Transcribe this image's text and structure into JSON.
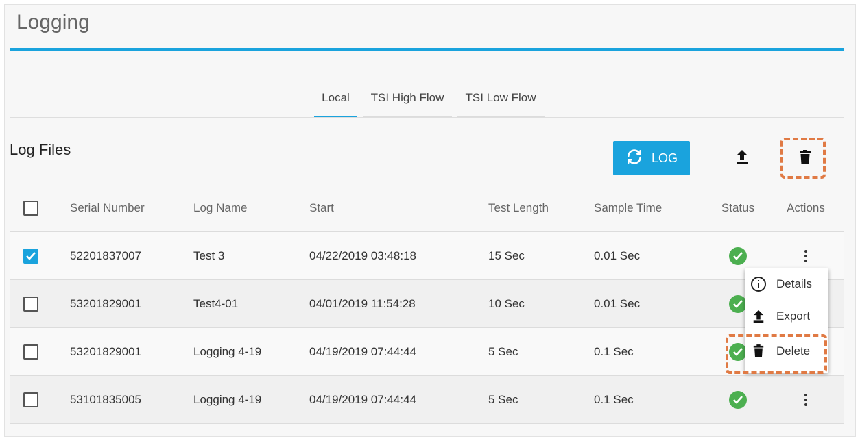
{
  "page": {
    "title": "Logging"
  },
  "tabs": [
    {
      "label": "Local",
      "active": true
    },
    {
      "label": "TSI High Flow",
      "active": false
    },
    {
      "label": "TSI Low Flow",
      "active": false
    }
  ],
  "section": {
    "title": "Log Files"
  },
  "toolbar": {
    "log_label": "LOG",
    "log_icon": "refresh-icon",
    "upload_icon": "upload-icon",
    "delete_icon": "trash-icon"
  },
  "table": {
    "columns": [
      "Serial Number",
      "Log Name",
      "Start",
      "Test Length",
      "Sample Time",
      "Status",
      "Actions"
    ],
    "rows": [
      {
        "checked": true,
        "serial": "52201837007",
        "name": "Test 3",
        "start": "04/22/2019 03:48:18",
        "length": "15 Sec",
        "sample": "0.01 Sec",
        "status": "ok"
      },
      {
        "checked": false,
        "serial": "53201829001",
        "name": "Test4-01",
        "start": "04/01/2019 11:54:28",
        "length": "10 Sec",
        "sample": "0.01 Sec",
        "status": "ok"
      },
      {
        "checked": false,
        "serial": "53201829001",
        "name": "Logging 4-19",
        "start": "04/19/2019 07:44:44",
        "length": "5 Sec",
        "sample": "0.1 Sec",
        "status": "ok"
      },
      {
        "checked": false,
        "serial": "53101835005",
        "name": "Logging 4-19",
        "start": "04/19/2019 07:44:44",
        "length": "5 Sec",
        "sample": "0.1 Sec",
        "status": "ok"
      }
    ]
  },
  "actions_menu": {
    "items": [
      {
        "label": "Details",
        "icon": "info-icon"
      },
      {
        "label": "Export",
        "icon": "upload-icon"
      },
      {
        "label": "Delete",
        "icon": "trash-icon"
      }
    ]
  },
  "colors": {
    "accent": "#1aa3dd",
    "status_ok": "#4caf50",
    "highlight_dash": "#e07a44"
  }
}
